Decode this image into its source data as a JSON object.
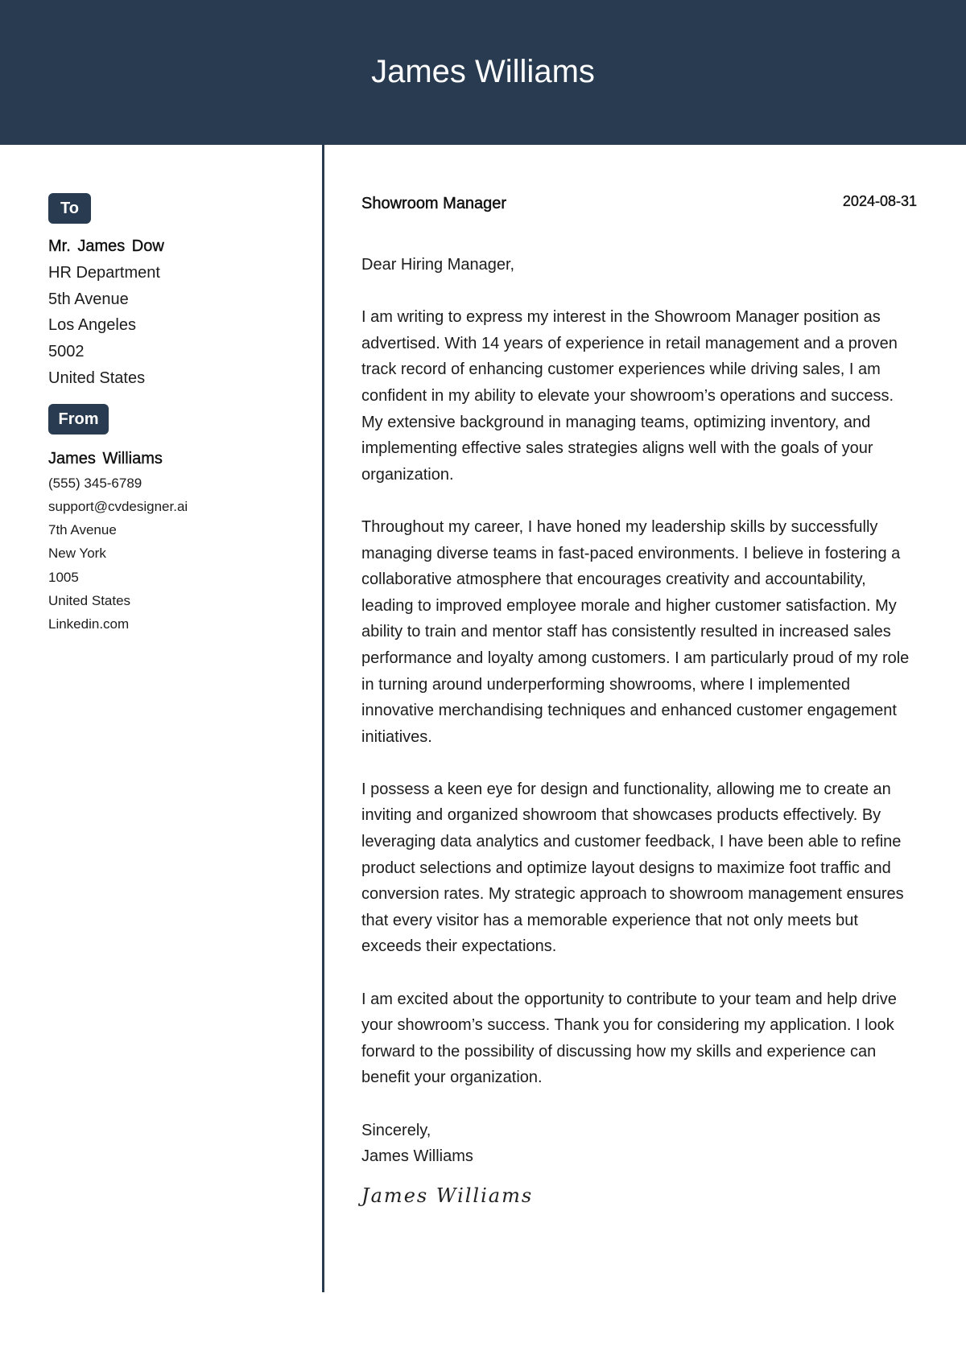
{
  "header": {
    "name": "James Williams"
  },
  "sidebar": {
    "to": {
      "badge_label": "To",
      "name": "Mr. James Dow",
      "lines": [
        "HR Department",
        "5th Avenue",
        "Los Angeles",
        "5002",
        "United States"
      ]
    },
    "from": {
      "badge_label": "From",
      "name": "James Williams",
      "lines": [
        "(555) 345-6789",
        "support@cvdesigner.ai",
        "7th Avenue",
        "New York",
        "1005",
        "United States",
        "Linkedin.com"
      ]
    }
  },
  "letter": {
    "job_title": "Showroom Manager",
    "date": "2024-08-31",
    "greeting": "Dear Hiring Manager,",
    "paragraphs": [
      "I am writing to express my interest in the Showroom Manager position as advertised. With 14 years of experience in retail management and a proven track record of enhancing customer experiences while driving sales, I am confident in my ability to elevate your showroom’s operations and success. My extensive background in managing teams, optimizing inventory, and implementing effective sales strategies aligns well with the goals of your organization.",
      "Throughout my career, I have honed my leadership skills by successfully managing diverse teams in fast-paced environments. I believe in fostering a collaborative atmosphere that encourages creativity and accountability, leading to improved employee morale and higher customer satisfaction. My ability to train and mentor staff has consistently resulted in increased sales performance and loyalty among customers. I am particularly proud of my role in turning around underperforming showrooms, where I implemented innovative merchandising techniques and enhanced customer engagement initiatives.",
      "I possess a keen eye for design and functionality, allowing me to create an inviting and organized showroom that showcases products effectively. By leveraging data analytics and customer feedback, I have been able to refine product selections and optimize layout designs to maximize foot traffic and conversion rates. My strategic approach to showroom management ensures that every visitor has a memorable experience that not only meets but exceeds their expectations.",
      "I am excited about the opportunity to contribute to your team and help drive your showroom’s success. Thank you for considering my application. I look forward to the possibility of discussing how my skills and experience can benefit your organization."
    ],
    "closing": "Sincerely,",
    "signer_name": "James Williams",
    "signature": "James Williams"
  },
  "colors": {
    "accent": "#283b50",
    "text": "#1c1c1c",
    "background": "#ffffff"
  }
}
